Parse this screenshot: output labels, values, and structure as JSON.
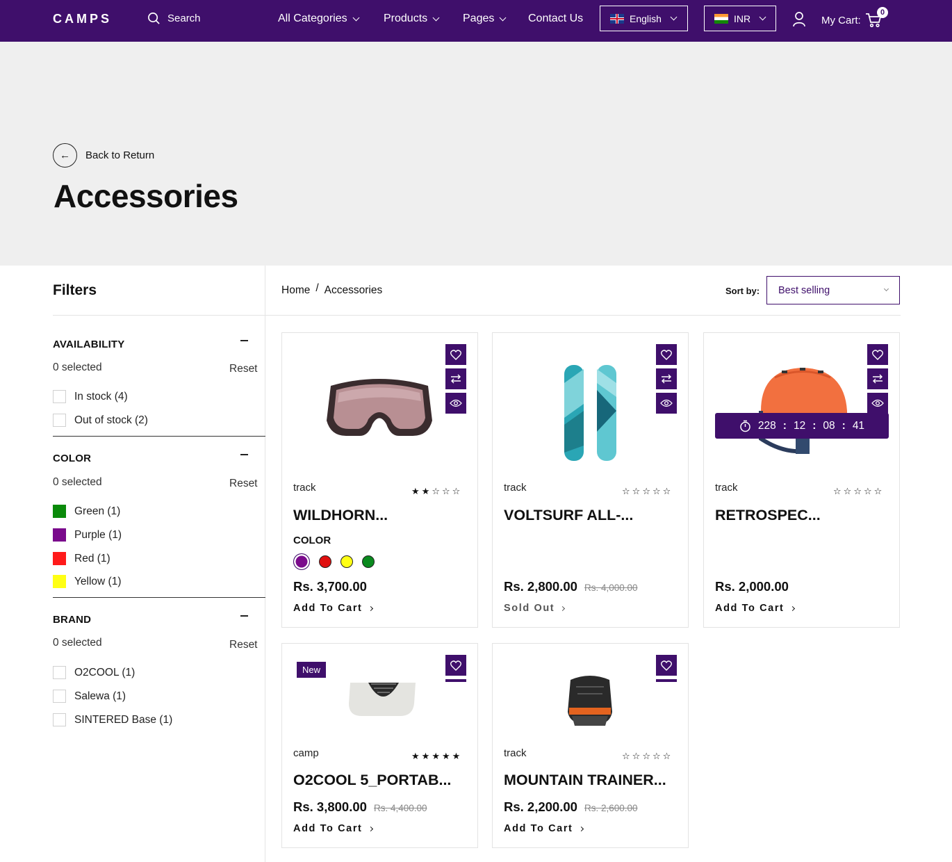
{
  "header": {
    "logo": "CAMPS",
    "search_label": "Search",
    "nav": [
      {
        "label": "All Categories"
      },
      {
        "label": "Products"
      },
      {
        "label": "Pages"
      },
      {
        "label": "Contact Us"
      }
    ],
    "language": "English",
    "currency": "INR",
    "cart_label": "My Cart:",
    "cart_count": "0"
  },
  "hero": {
    "back_label": "Back to Return",
    "title": "Accessories"
  },
  "filters": {
    "title": "Filters",
    "groups": [
      {
        "title": "AVAILABILITY",
        "selected": "0 selected",
        "reset": "Reset",
        "options": [
          "In stock (4)",
          "Out of stock (2)"
        ]
      },
      {
        "title": "COLOR",
        "selected": "0 selected",
        "reset": "Reset",
        "options": [
          "Green (1)",
          "Purple (1)",
          "Red (1)",
          "Yellow (1)"
        ],
        "swatches": [
          "#0a8a0a",
          "#7a0a8c",
          "#ff1a1a",
          "#ffff14"
        ]
      },
      {
        "title": "BRAND",
        "selected": "0 selected",
        "reset": "Reset",
        "options": [
          "O2COOL (1)",
          "Salewa (1)",
          "SINTERED Base (1)"
        ]
      }
    ]
  },
  "breadcrumb": {
    "home": "Home",
    "sep": "/",
    "current": "Accessories"
  },
  "sort": {
    "label": "Sort by:",
    "value": "Best selling"
  },
  "products": [
    {
      "vendor": "track",
      "rating": 2,
      "title": "WILDHORN...",
      "color_label": "COLOR",
      "colors": [
        "#7a0a8c",
        "#e01010",
        "#ffff14",
        "#0a8a1e"
      ],
      "price": "Rs. 3,700.00",
      "old_price": "",
      "action": "Add To Cart"
    },
    {
      "vendor": "track",
      "rating": 0,
      "title": "VOLTSURF ALL-...",
      "price": "Rs. 2,800.00",
      "old_price": "Rs. 4,000.00",
      "action": "Sold Out"
    },
    {
      "vendor": "track",
      "rating": 0,
      "title": "RETROSPEC...",
      "price": "Rs. 2,000.00",
      "old_price": "",
      "action": "Add To Cart",
      "timer": [
        "228",
        "12",
        "08",
        "41"
      ]
    },
    {
      "vendor": "camp",
      "rating": 5,
      "title": "O2COOL 5_PORTAB...",
      "price": "Rs. 3,800.00",
      "old_price": "Rs. 4,400.00",
      "action": "Add To Cart",
      "badge": "New"
    },
    {
      "vendor": "track",
      "rating": 0,
      "title": "MOUNTAIN TRAINER...",
      "price": "Rs. 2,200.00",
      "old_price": "Rs. 2,600.00",
      "action": "Add To Cart"
    }
  ],
  "colors": {
    "brand": "#3f0f6b",
    "hero_bg": "#efefef"
  }
}
